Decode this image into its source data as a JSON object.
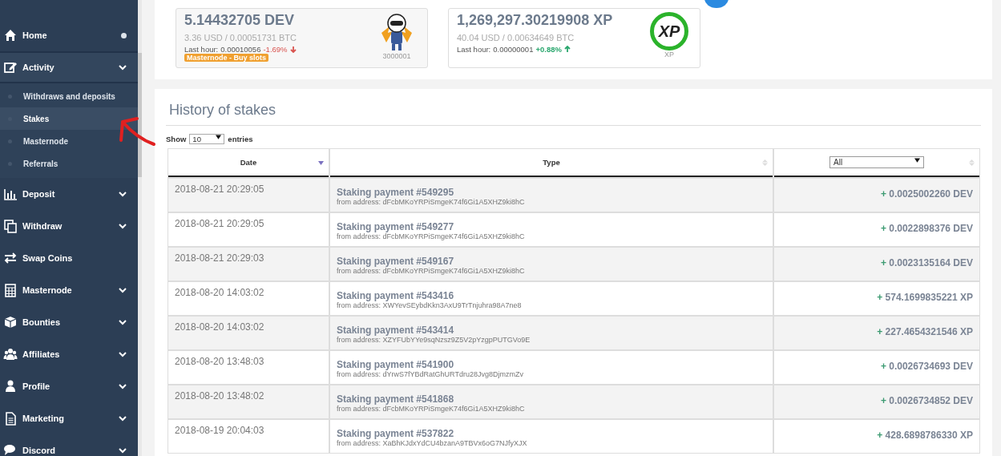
{
  "sidebar": {
    "items": [
      {
        "label": "Home",
        "kind": "dot"
      },
      {
        "label": "Activity",
        "kind": "dropdown",
        "expanded": true,
        "children": [
          {
            "label": "Withdraws and deposits",
            "selected": false
          },
          {
            "label": "Stakes",
            "selected": true
          },
          {
            "label": "Masternode",
            "selected": false
          },
          {
            "label": "Referrals",
            "selected": false
          }
        ]
      },
      {
        "label": "Deposit",
        "kind": "dropdown"
      },
      {
        "label": "Withdraw",
        "kind": "dropdown"
      },
      {
        "label": "Swap Coins",
        "kind": "link"
      },
      {
        "label": "Masternode",
        "kind": "dropdown"
      },
      {
        "label": "Bounties",
        "kind": "dropdown"
      },
      {
        "label": "Affiliates",
        "kind": "dropdown"
      },
      {
        "label": "Profile",
        "kind": "dropdown"
      },
      {
        "label": "Marketing",
        "kind": "dropdown"
      },
      {
        "label": "Discord",
        "kind": "dropdown"
      }
    ]
  },
  "wallets": [
    {
      "balance": "5.14432705 DEV",
      "value": "3.36 USD / 0.00051731 BTC",
      "last_hour_label": "Last hour:",
      "last_hour": "0.00010056",
      "change": "-1.69%",
      "kind": "loss",
      "badge": "Masternode - Buy slots",
      "caption": "3000001"
    },
    {
      "balance": "1,269,297.30219908 XP",
      "value": "40.04 USD / 0.00634649 BTC",
      "last_hour_label": "Last hour:",
      "last_hour": "0.00000001",
      "change": "+0.88%",
      "kind": "gain",
      "logo_text": "XP",
      "caption": "XP"
    }
  ],
  "history": {
    "title": "History of stakes",
    "show_label": "Show",
    "page_size": "10",
    "entries_label": "entries",
    "columns": [
      {
        "label": "Date",
        "sorted": true
      },
      {
        "label": "Type",
        "sorted": false
      }
    ],
    "filter": "All",
    "rows": [
      {
        "date": "2018-08-21 20:29:05",
        "title": "Staking payment #549295",
        "address": "from address: dFcbMKoYRPiSmgeK74f6Gi1A5XHZ9ki8hC",
        "sign": "+",
        "amount": "0.0025002260 DEV"
      },
      {
        "date": "2018-08-21 20:29:05",
        "title": "Staking payment #549277",
        "address": "from address: dFcbMKoYRPiSmgeK74f6Gi1A5XHZ9ki8hC",
        "sign": "+",
        "amount": "0.0022898376 DEV"
      },
      {
        "date": "2018-08-21 20:29:03",
        "title": "Staking payment #549167",
        "address": "from address: dFcbMKoYRPiSmgeK74f6Gi1A5XHZ9ki8hC",
        "sign": "+",
        "amount": "0.0023135164 DEV"
      },
      {
        "date": "2018-08-20 14:03:02",
        "title": "Staking payment #543416",
        "address": "from address: XWYevSEybdKkn3AxU9TrTnjuhra98A7ne8",
        "sign": "+",
        "amount": "574.1699835221 XP"
      },
      {
        "date": "2018-08-20 14:03:02",
        "title": "Staking payment #543414",
        "address": "from address: XZYFUbYYe9sqNzsz9Z5V2pYzgpPUTGVo9E",
        "sign": "+",
        "amount": "227.4654321546 XP"
      },
      {
        "date": "2018-08-20 13:48:03",
        "title": "Staking payment #541900",
        "address": "from address: dYrwS7fYBdRatGhURTdru28Jvg8DjmzmZv",
        "sign": "+",
        "amount": "0.0026734693 DEV"
      },
      {
        "date": "2018-08-20 13:48:02",
        "title": "Staking payment #541868",
        "address": "from address: dFcbMKoYRPiSmgeK74f6Gi1A5XHZ9ki8hC",
        "sign": "+",
        "amount": "0.0026734852 DEV"
      },
      {
        "date": "2018-08-19 20:04:03",
        "title": "Staking payment #537822",
        "address": "from address: XaBhKJdxYdCU4bzanA9TBVx6oG7NJfyXJX",
        "sign": "+",
        "amount": "428.6898786330 XP"
      }
    ]
  }
}
